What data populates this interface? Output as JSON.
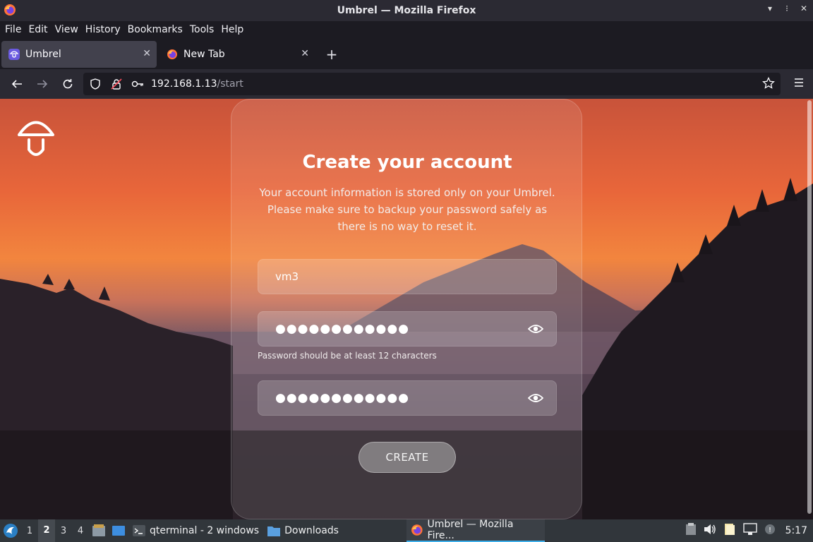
{
  "window": {
    "title": "Umbrel — Mozilla Firefox"
  },
  "menubar": {
    "items": [
      "File",
      "Edit",
      "View",
      "History",
      "Bookmarks",
      "Tools",
      "Help"
    ]
  },
  "tabs": [
    {
      "label": "Umbrel",
      "active": true
    },
    {
      "label": "New Tab",
      "active": false
    }
  ],
  "urlbar": {
    "host": "192.168.1.13",
    "path": "/start"
  },
  "page": {
    "title": "Create your account",
    "description": "Your account information is stored only on your Umbrel. Please make sure to backup your password safely as there is no way to reset it.",
    "name_value": "vm3",
    "password_dots": "●●●●●●●●●●●●",
    "password_hint": "Password should be at least 12 characters",
    "confirm_dots": "●●●●●●●●●●●●",
    "create_label": "CREATE"
  },
  "taskbar": {
    "desktops": [
      "1",
      "2",
      "3",
      "4"
    ],
    "active_desktop": "2",
    "tasks": [
      {
        "label": "qterminal - 2 windows"
      },
      {
        "label": "Downloads"
      },
      {
        "label": "Umbrel — Mozilla Fire..."
      }
    ],
    "clock": "5:17"
  },
  "colors": {
    "accent": "#3daee9",
    "firefox_chrome": "#2b2a33"
  }
}
